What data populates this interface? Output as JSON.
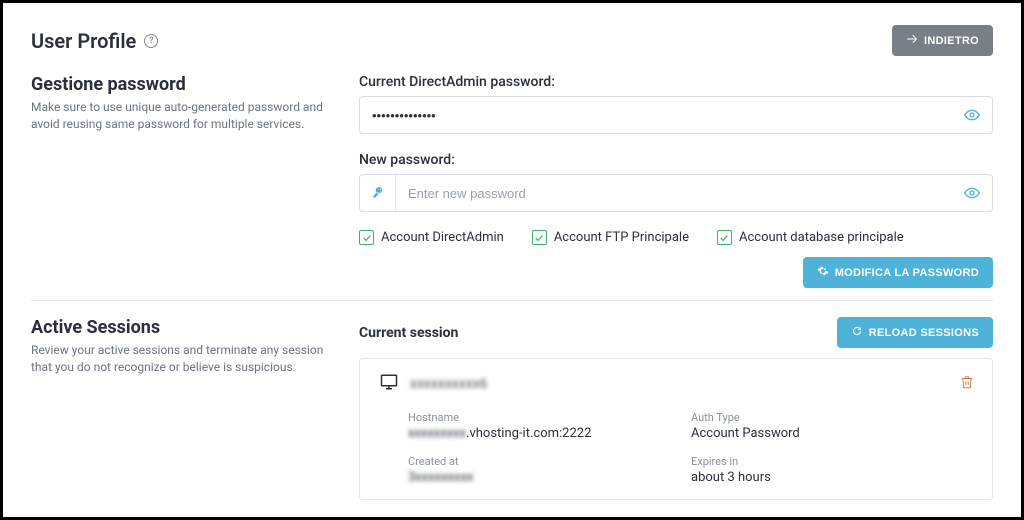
{
  "header": {
    "title": "User Profile",
    "back_label": "INDIETRO"
  },
  "password_section": {
    "heading": "Gestione password",
    "desc": "Make sure to use unique auto-generated password and avoid reusing same password for multiple services.",
    "current_label": "Current DirectAdmin password:",
    "current_value": "••••••••••••••",
    "new_label": "New password:",
    "new_placeholder": "Enter new password",
    "check_da": "Account DirectAdmin",
    "check_ftp": "Account FTP Principale",
    "check_db": "Account database principale",
    "submit_label": "MODIFICA LA PASSWORD"
  },
  "sessions_section": {
    "heading": "Active Sessions",
    "desc": "Review your active sessions and terminate any session that you do not recognize or believe is suspicious.",
    "current_title": "Current session",
    "reload_label": "RELOAD SESSIONS",
    "session": {
      "ip_masked": "xxxxxxxxxx6",
      "hostname_label": "Hostname",
      "hostname_value_prefix": "xxxxxxxxx",
      "hostname_value_suffix": ".vhosting-it.com:2222",
      "authtype_label": "Auth Type",
      "authtype_value": "Account Password",
      "created_label": "Created at",
      "created_value": "3xxxxxxxxx",
      "expires_label": "Expires in",
      "expires_value": "about 3 hours"
    }
  }
}
